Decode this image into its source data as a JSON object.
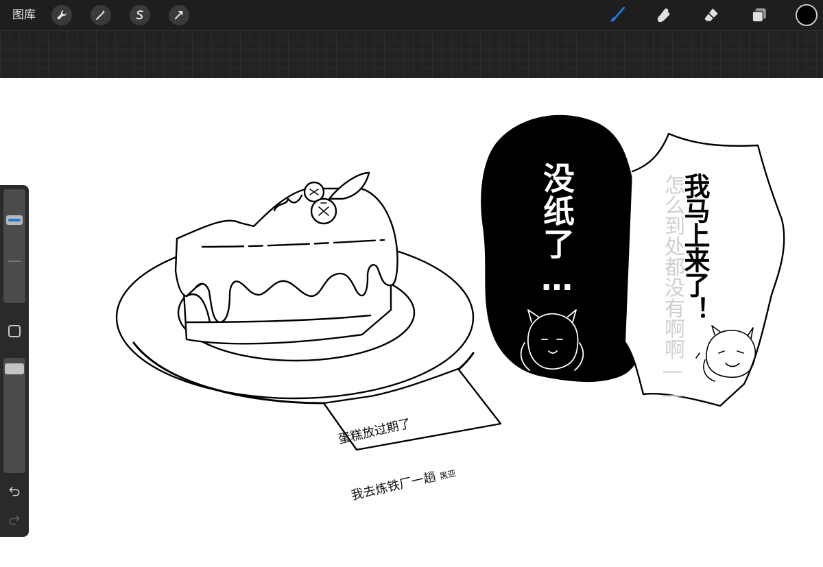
{
  "toolbar": {
    "gallery_label": "图库",
    "left_tools": [
      {
        "name": "actions",
        "icon": "wrench-icon"
      },
      {
        "name": "adjustments",
        "icon": "magic-wand-icon"
      },
      {
        "name": "selection",
        "icon": "selection-s-icon"
      },
      {
        "name": "transform",
        "icon": "arrow-cursor-icon"
      }
    ],
    "right_tools": [
      {
        "name": "brush",
        "icon": "brush-icon",
        "active": true
      },
      {
        "name": "smudge",
        "icon": "smudge-finger-icon"
      },
      {
        "name": "eraser",
        "icon": "eraser-icon"
      },
      {
        "name": "layers",
        "icon": "layers-icon"
      }
    ],
    "current_color": "#000000",
    "accent_color": "#1f7ae0"
  },
  "sidebar": {
    "size_level": 0.75,
    "opacity_level": 0.05,
    "undo_icon": "undo-icon",
    "redo_icon": "redo-icon",
    "modifier_icon": "modifier-square-icon"
  },
  "artwork": {
    "bubble_left": "没纸了…",
    "bubble_right_main": "我马上来了！",
    "bubble_right_background": "怎么到处都没有啊啊——",
    "note_line1": "蛋糕放过期了",
    "note_line2": "我去炼铁厂一趟",
    "note_sign": "黑亚"
  }
}
